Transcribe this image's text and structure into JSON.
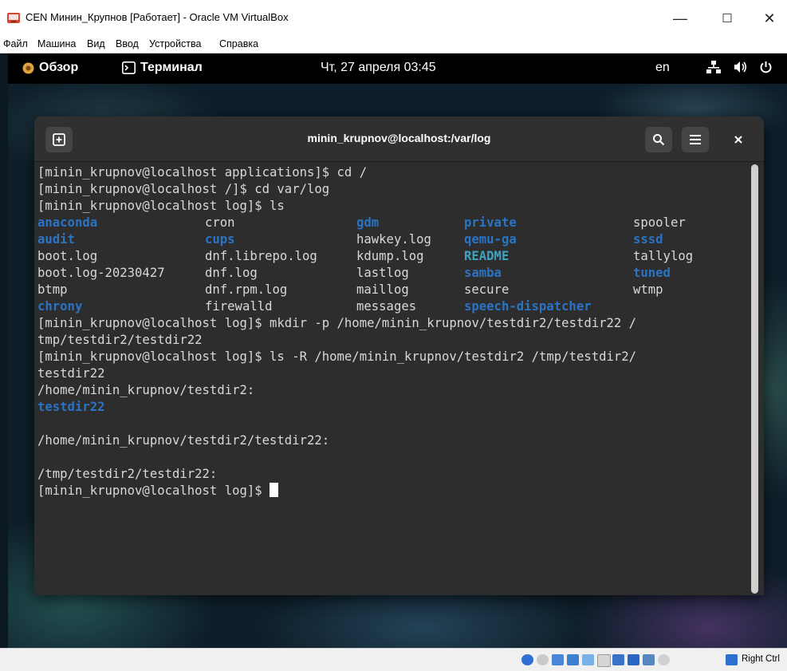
{
  "window": {
    "title": "CEN Минин_Крупнов [Работает] - Oracle VM VirtualBox",
    "minimize": "—",
    "maximize": "☐",
    "close": "✕"
  },
  "menu": [
    "Файл",
    "Машина",
    "Вид",
    "Ввод",
    "Устройства",
    "Справка"
  ],
  "gnome": {
    "overview": "Обзор",
    "app": "Терминал",
    "datetime": "Чт, 27 апреля  03:45",
    "lang": "en"
  },
  "terminal": {
    "title": "minin_krupnov@localhost:/var/log",
    "lines": [
      "[minin_krupnov@localhost applications]$ cd /",
      "[minin_krupnov@localhost /]$ cd var/log",
      "[minin_krupnov@localhost log]$ ls",
      "[minin_krupnov@localhost log]$ mkdir -p /home/minin_krupnov/testdir2/testdir22 /",
      "tmp/testdir2/testdir22",
      "[minin_krupnov@localhost log]$ ls -R /home/minin_krupnov/testdir2 /tmp/testdir2/",
      "testdir22",
      "/home/minin_krupnov/testdir2:",
      "testdir22",
      "",
      "/home/minin_krupnov/testdir2/testdir22:",
      "",
      "/tmp/testdir2/testdir22:",
      "[minin_krupnov@localhost log]$ "
    ],
    "ls_grid": [
      [
        "anaconda",
        "cron",
        "gdm",
        "private",
        "spooler"
      ],
      [
        "audit",
        "cups",
        "hawkey.log",
        "qemu-ga",
        "sssd"
      ],
      [
        "boot.log",
        "dnf.librepo.log",
        "kdump.log",
        "README",
        "tallylog"
      ],
      [
        "boot.log-20230427",
        "dnf.log",
        "lastlog",
        "samba",
        "tuned"
      ],
      [
        "btmp",
        "dnf.rpm.log",
        "maillog",
        "secure",
        "wtmp"
      ],
      [
        "chrony",
        "firewalld",
        "messages",
        "speech-dispatcher",
        ""
      ]
    ],
    "ls_types": [
      [
        "dir",
        "file",
        "dir",
        "dir",
        "file"
      ],
      [
        "dir",
        "dir",
        "file",
        "dir",
        "dir"
      ],
      [
        "file",
        "file",
        "file",
        "readme",
        "file"
      ],
      [
        "file",
        "file",
        "file",
        "dir",
        "dir"
      ],
      [
        "file",
        "file",
        "file",
        "file",
        "file"
      ],
      [
        "dir",
        "file",
        "file",
        "dir",
        "file"
      ]
    ]
  },
  "status": {
    "host_key": "Right Ctrl"
  },
  "colors": {
    "dir": "#2a73c5",
    "readme": "#3ea3c0",
    "text": "#d8d8d8",
    "term_bg": "#2d2d2d"
  }
}
